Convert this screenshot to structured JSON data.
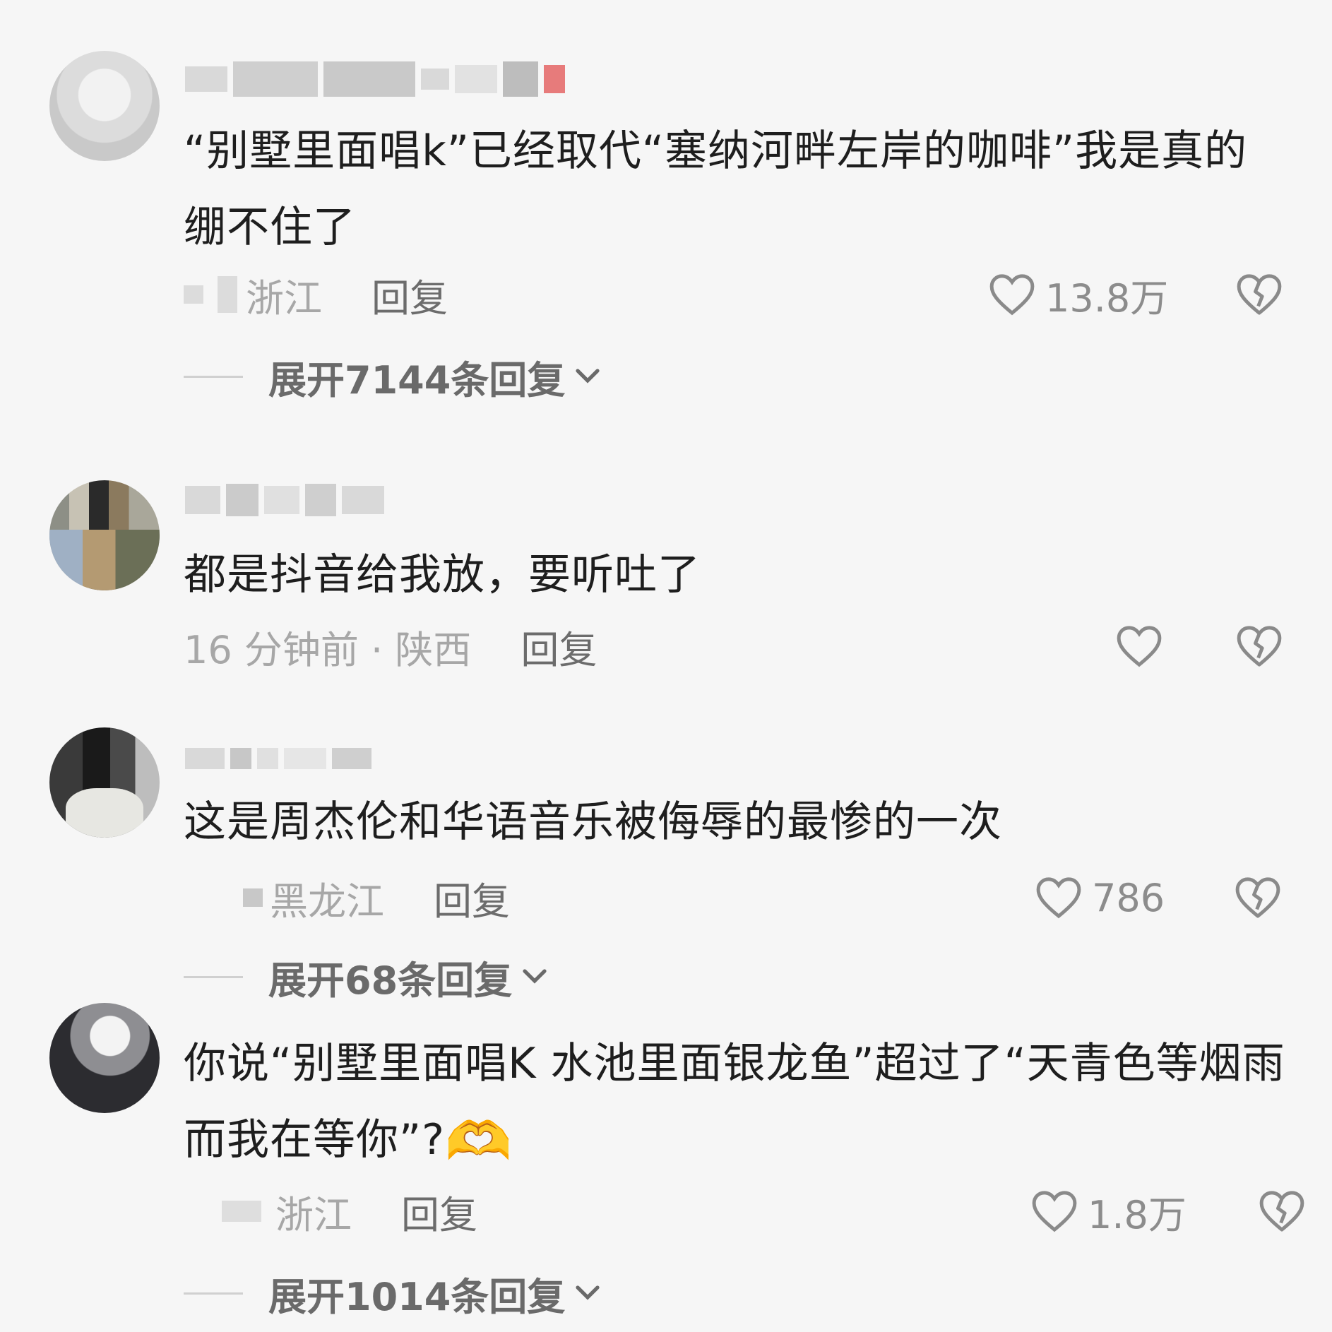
{
  "comments": [
    {
      "text": "“别墅里面唱k”已经取代“塞纳河畔左岸的咖啡”我是真的绷不住了",
      "meta": "浙江",
      "reply_label": "回复",
      "likes": "13.8万",
      "expand_label": "展开7144条回复"
    },
    {
      "text": "都是抖音给我放，要听吐了",
      "meta": "16 分钟前 · 陕西",
      "reply_label": "回复",
      "likes": "",
      "expand_label": ""
    },
    {
      "text": "这是周杰伦和华语音乐被侮辱的最惨的一次",
      "meta": "黑龙江",
      "reply_label": "回复",
      "likes": "786",
      "expand_label": "展开68条回复"
    },
    {
      "text": "你说“别墅里面唱K 水池里面银龙鱼”超过了“天青色等烟雨 而我在等你”?",
      "emoji": "🫶",
      "meta": "浙江",
      "reply_label": "回复",
      "likes": "1.8万",
      "expand_label": "展开1014条回复"
    }
  ],
  "icons": {
    "like": "heart-outline-icon",
    "dislike": "broken-heart-icon",
    "expand": "chevron-down-icon"
  }
}
